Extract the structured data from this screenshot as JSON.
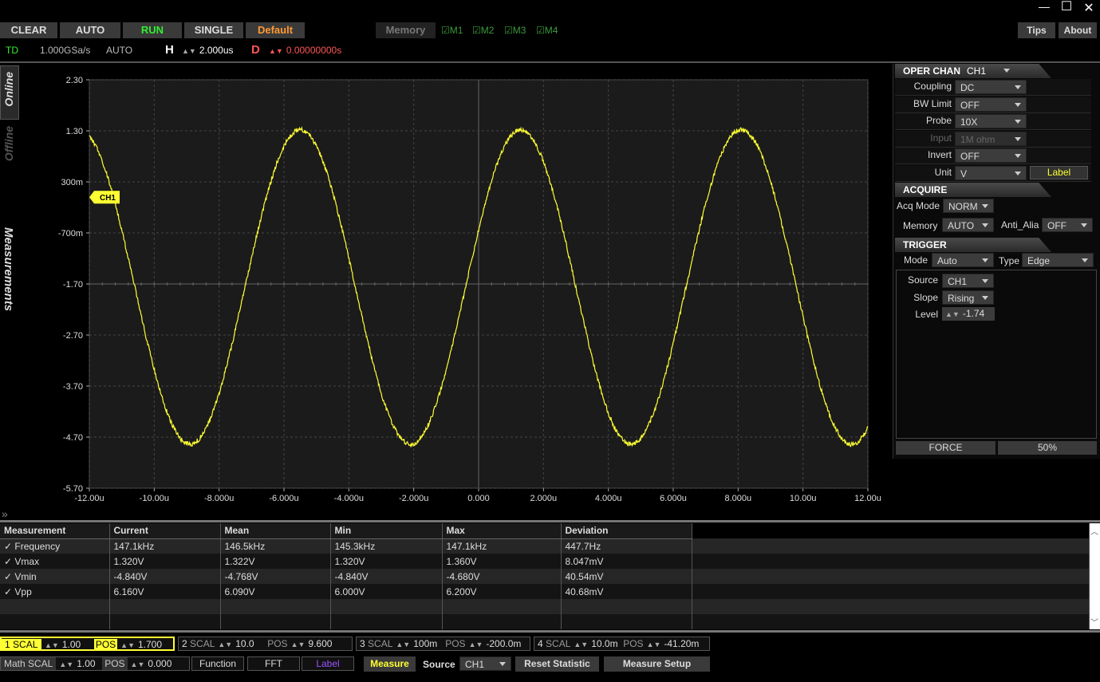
{
  "window": {
    "min": "—",
    "max": "☐",
    "close": "✕"
  },
  "toolbar": {
    "clear": "CLEAR",
    "auto": "AUTO",
    "run": "RUN",
    "single": "SINGLE",
    "default": "Default",
    "memory": "Memory",
    "m1": "M1",
    "m2": "M2",
    "m3": "M3",
    "m4": "M4",
    "tips": "Tips",
    "about": "About"
  },
  "status": {
    "mode": "TD",
    "rate": "1.000GSa/s",
    "acq": "AUTO",
    "h_label": "H",
    "h_value": "2.000us",
    "d_label": "D",
    "d_value": "0.00000000s"
  },
  "sidetabs": {
    "online": "Online",
    "offline": "Offline",
    "measurements": "Measurements"
  },
  "plot": {
    "ch_marker": "CH1",
    "y_ticks": [
      "2.30",
      "1.30",
      "300m",
      "-700m",
      "-1.70",
      "-2.70",
      "-3.70",
      "-4.70",
      "-5.70"
    ],
    "x_ticks": [
      "-12.00u",
      "-10.00u",
      "-8.000u",
      "-6.000u",
      "-4.000u",
      "-2.000u",
      "0.000",
      "2.000u",
      "4.000u",
      "6.000u",
      "8.000u",
      "10.00u",
      "12.00u"
    ],
    "trace_color": "#ffff33"
  },
  "chart_data": {
    "type": "line",
    "x_range_us": [
      -12,
      12
    ],
    "y_range_V": [
      -5.7,
      2.3
    ],
    "series": [
      {
        "name": "CH1",
        "waveform": "sine",
        "frequency_kHz": 147.1,
        "vmax_V": 1.32,
        "vmin_V": -4.84,
        "peak_times_us": [
          -5.5,
          1.3,
          8.1
        ],
        "trough_times_us": [
          -8.3,
          -1.5,
          5.3
        ]
      }
    ]
  },
  "oper": {
    "header": "OPER CHAN",
    "chan": "CH1",
    "rows": [
      {
        "label": "Coupling",
        "value": "DC"
      },
      {
        "label": "BW Limit",
        "value": "OFF"
      },
      {
        "label": "Probe",
        "value": "10X"
      },
      {
        "label": "Input",
        "value": "1M ohm"
      },
      {
        "label": "Invert",
        "value": "OFF"
      },
      {
        "label": "Unit",
        "value": "V"
      }
    ],
    "label_btn": "Label"
  },
  "acquire": {
    "header": "ACQUIRE",
    "acq_mode_label": "Acq Mode",
    "acq_mode": "NORM",
    "memory_label": "Memory",
    "memory": "AUTO",
    "anti_label": "Anti_Alia",
    "anti": "OFF"
  },
  "trigger": {
    "header": "TRIGGER",
    "mode_label": "Mode",
    "mode": "Auto",
    "type_label": "Type",
    "type": "Edge",
    "source_label": "Source",
    "source": "CH1",
    "slope_label": "Slope",
    "slope": "Rising",
    "level_label": "Level",
    "level": "-1.74",
    "force": "FORCE",
    "fifty": "50%"
  },
  "measure_table": {
    "headers": [
      "Measurement",
      "Current",
      "Mean",
      "Min",
      "Max",
      "Deviation"
    ],
    "rows": [
      [
        "✓  Frequency",
        "147.1kHz",
        "146.5kHz",
        "145.3kHz",
        "147.1kHz",
        "447.7Hz"
      ],
      [
        "✓  Vmax",
        "1.320V",
        "1.322V",
        "1.320V",
        "1.360V",
        "8.047mV"
      ],
      [
        "✓  Vmin",
        "-4.840V",
        "-4.768V",
        "-4.840V",
        "-4.680V",
        "40.54mV"
      ],
      [
        "✓  Vpp",
        "6.160V",
        "6.090V",
        "6.000V",
        "6.200V",
        "40.68mV"
      ]
    ]
  },
  "channels": [
    {
      "num": "1",
      "scal_label": "SCAL",
      "scal": "1.00",
      "pos_label": "POS",
      "pos": "1.700"
    },
    {
      "num": "2",
      "scal_label": "SCAL",
      "scal": "10.0",
      "pos_label": "POS",
      "pos": "9.600"
    },
    {
      "num": "3",
      "scal_label": "SCAL",
      "scal": "100m",
      "pos_label": "POS",
      "pos": "-200.0m"
    },
    {
      "num": "4",
      "scal_label": "SCAL",
      "scal": "10.0m",
      "pos_label": "POS",
      "pos": "-41.20m"
    }
  ],
  "math": {
    "scal_label": "Math SCAL",
    "scal": "1.00",
    "pos_label": "POS",
    "pos": "0.000",
    "function": "Function",
    "fft": "FFT",
    "label": "Label",
    "measure": "Measure",
    "source_label": "Source",
    "source": "CH1",
    "reset": "Reset  Statistic",
    "setup": "Measure Setup"
  }
}
